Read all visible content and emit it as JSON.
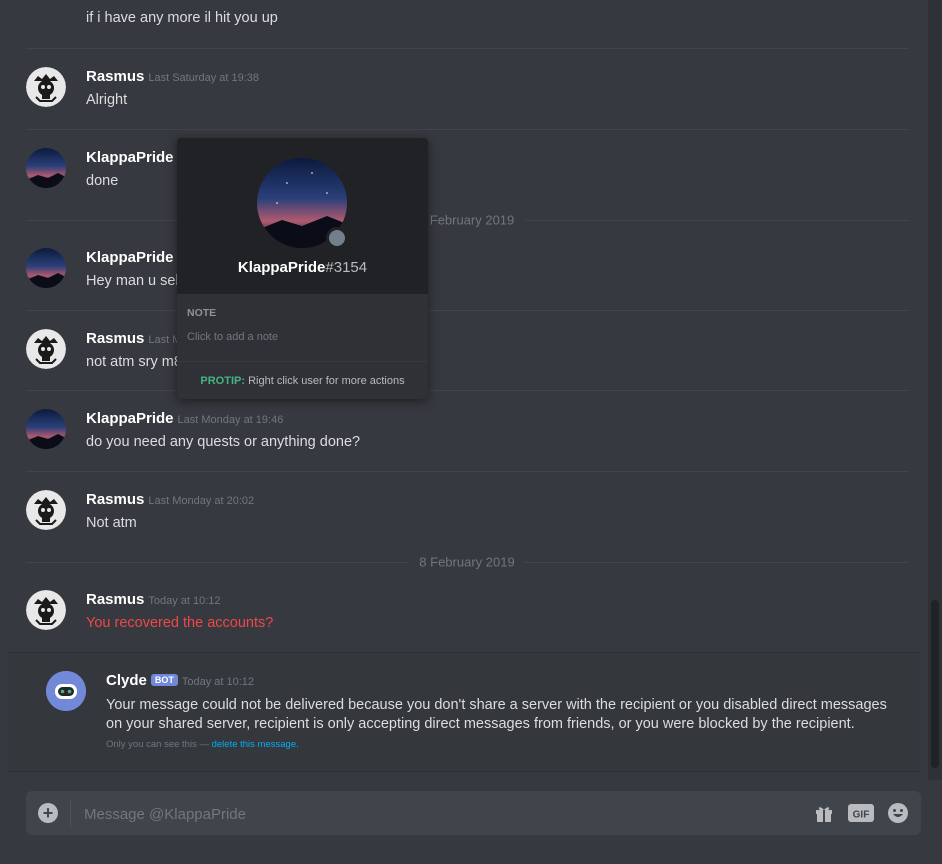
{
  "messages": [
    {
      "user": "",
      "time": "",
      "text": "if i have any more il hit you up"
    },
    {
      "user": "Rasmus",
      "time": "Last Saturday at 19:38",
      "text": "Alright"
    },
    {
      "user": "KlappaPride",
      "time": "",
      "text": "done"
    },
    {
      "user": "KlappaPride",
      "time": "",
      "text": "Hey man u sell"
    },
    {
      "user": "Rasmus",
      "time": "Last M",
      "text": "not atm sry m8"
    },
    {
      "user": "KlappaPride",
      "time": "Last Monday at 19:46",
      "text": "do you need any quests or anything done?"
    },
    {
      "user": "Rasmus",
      "time": "Last Monday at 20:02",
      "text": "Not atm"
    },
    {
      "user": "Rasmus",
      "time": "Today at 10:12",
      "text": "You recovered the accounts?"
    }
  ],
  "dividers": [
    "February 2019",
    "8 February 2019"
  ],
  "clyde": {
    "name": "Clyde",
    "bot_tag": "BOT",
    "time": "Today at 10:12",
    "text": "Your message could not be delivered because you don't share a server with the recipient or you disabled direct messages on your shared server, recipient is only accepting direct messages from friends, or you were blocked by the recipient.",
    "note_prefix": "Only you can see this —",
    "note_link": "delete this message."
  },
  "composer": {
    "placeholder": "Message @KlappaPride"
  },
  "popout": {
    "username": "KlappaPride",
    "discriminator": "#3154",
    "note_title": "NOTE",
    "note_placeholder": "Click to add a note",
    "protip_label": "PROTIP:",
    "protip_text": "Right click user for more actions"
  },
  "colors": {
    "background": "#36393f",
    "error_text": "#f04747",
    "bot_tag": "#7289da",
    "protip": "#43b581",
    "link": "#00b0f4"
  },
  "icons": [
    "plus-icon",
    "gift-icon",
    "gif-icon",
    "emoji-icon",
    "skull-avatar-icon",
    "clyde-robot-icon"
  ]
}
